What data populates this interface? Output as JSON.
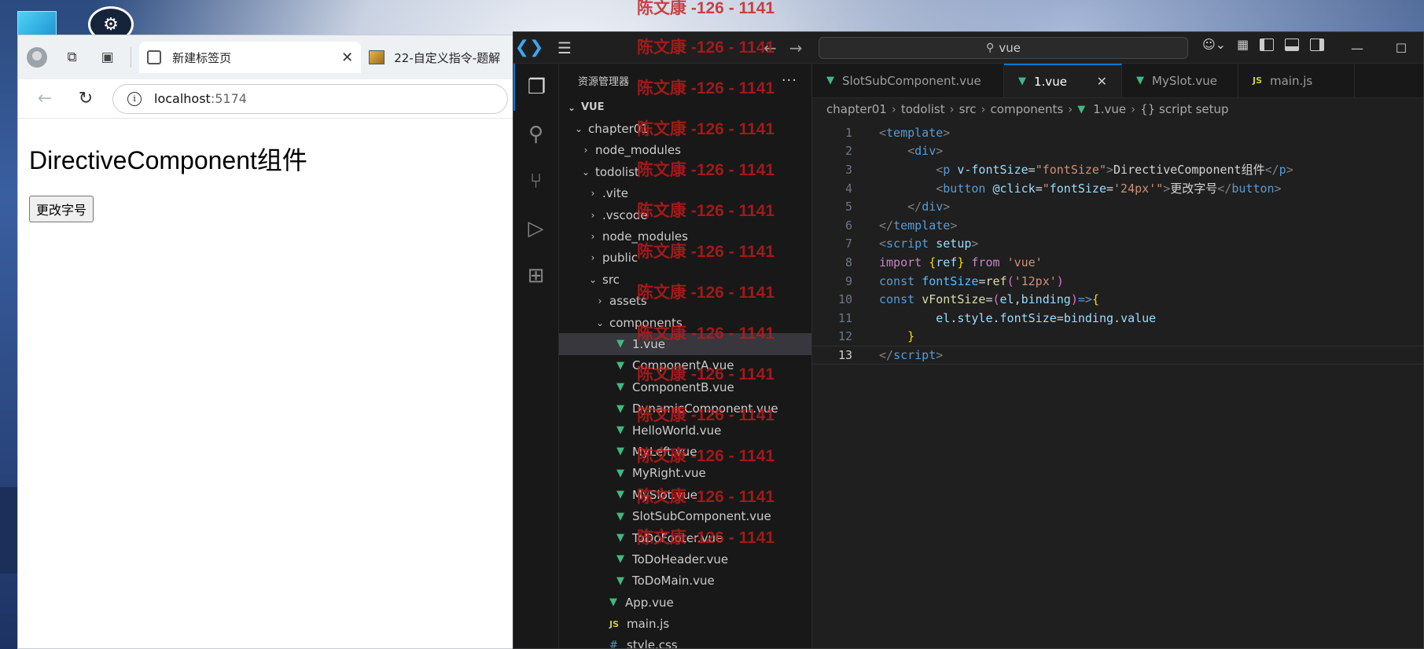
{
  "browser": {
    "tabs": [
      {
        "label": "新建标签页",
        "active": true
      },
      {
        "label": "22-自定义指令-题解",
        "active": false
      }
    ],
    "url_host": "localhost",
    "url_port": ":5174",
    "page_heading": "DirectiveComponent组件",
    "page_button": "更改字号"
  },
  "vscode": {
    "search_text": "vue",
    "explorer_title": "资源管理器",
    "tree": [
      {
        "label": "VUE",
        "depth": 0,
        "type": "root",
        "expanded": true
      },
      {
        "label": "chapter01",
        "depth": 1,
        "type": "folder",
        "expanded": true
      },
      {
        "label": "node_modules",
        "depth": 2,
        "type": "folder",
        "expanded": false
      },
      {
        "label": "todolist",
        "depth": 2,
        "type": "folder",
        "expanded": true
      },
      {
        "label": ".vite",
        "depth": 3,
        "type": "folder",
        "expanded": false
      },
      {
        "label": ".vscode",
        "depth": 3,
        "type": "folder",
        "expanded": false
      },
      {
        "label": "node_modules",
        "depth": 3,
        "type": "folder",
        "expanded": false
      },
      {
        "label": "public",
        "depth": 3,
        "type": "folder",
        "expanded": false
      },
      {
        "label": "src",
        "depth": 3,
        "type": "folder",
        "expanded": true
      },
      {
        "label": "assets",
        "depth": 4,
        "type": "folder",
        "expanded": false
      },
      {
        "label": "components",
        "depth": 4,
        "type": "folder",
        "expanded": true
      },
      {
        "label": "1.vue",
        "depth": 5,
        "type": "vue",
        "selected": true
      },
      {
        "label": "ComponentA.vue",
        "depth": 5,
        "type": "vue"
      },
      {
        "label": "ComponentB.vue",
        "depth": 5,
        "type": "vue"
      },
      {
        "label": "DynamicComponent.vue",
        "depth": 5,
        "type": "vue"
      },
      {
        "label": "HelloWorld.vue",
        "depth": 5,
        "type": "vue"
      },
      {
        "label": "MyLeft.vue",
        "depth": 5,
        "type": "vue"
      },
      {
        "label": "MyRight.vue",
        "depth": 5,
        "type": "vue"
      },
      {
        "label": "MySlot.vue",
        "depth": 5,
        "type": "vue"
      },
      {
        "label": "SlotSubComponent.vue",
        "depth": 5,
        "type": "vue"
      },
      {
        "label": "ToDoFooter.vue",
        "depth": 5,
        "type": "vue"
      },
      {
        "label": "ToDoHeader.vue",
        "depth": 5,
        "type": "vue"
      },
      {
        "label": "ToDoMain.vue",
        "depth": 5,
        "type": "vue"
      },
      {
        "label": "App.vue",
        "depth": 4,
        "type": "vue"
      },
      {
        "label": "main.js",
        "depth": 4,
        "type": "js"
      },
      {
        "label": "style.css",
        "depth": 4,
        "type": "css"
      }
    ],
    "editor_tabs": [
      {
        "label": "SlotSubComponent.vue",
        "type": "vue",
        "active": false
      },
      {
        "label": "1.vue",
        "type": "vue",
        "active": true
      },
      {
        "label": "MySlot.vue",
        "type": "vue",
        "active": false
      },
      {
        "label": "main.js",
        "type": "js",
        "active": false
      }
    ],
    "breadcrumb": [
      "chapter01",
      "todolist",
      "src",
      "components",
      "1.vue",
      "{} script setup"
    ],
    "current_line": 13,
    "code_lines": [
      [
        [
          "t-bracket",
          "<"
        ],
        [
          "t-tag",
          "template"
        ],
        [
          "t-bracket",
          ">"
        ]
      ],
      [
        [
          "",
          "    "
        ],
        [
          "t-bracket",
          "<"
        ],
        [
          "t-tag",
          "div"
        ],
        [
          "t-bracket",
          ">"
        ]
      ],
      [
        [
          "",
          "        "
        ],
        [
          "t-bracket",
          "<"
        ],
        [
          "t-tag",
          "p"
        ],
        [
          "",
          " "
        ],
        [
          "t-attr",
          "v-fontSize"
        ],
        [
          "t-text",
          "="
        ],
        [
          "t-str",
          "\"fontSize\""
        ],
        [
          "t-bracket",
          ">"
        ],
        [
          "t-text",
          "DirectiveComponent组件"
        ],
        [
          "t-bracket",
          "</"
        ],
        [
          "t-tag",
          "p"
        ],
        [
          "t-bracket",
          ">"
        ]
      ],
      [
        [
          "",
          "        "
        ],
        [
          "t-bracket",
          "<"
        ],
        [
          "t-tag",
          "button"
        ],
        [
          "",
          " "
        ],
        [
          "t-attr",
          "@click"
        ],
        [
          "t-text",
          "="
        ],
        [
          "t-str",
          "\""
        ],
        [
          "t-var",
          "fontSize"
        ],
        [
          "t-text",
          "="
        ],
        [
          "t-str",
          "'24px'"
        ],
        [
          "t-str",
          "\""
        ],
        [
          "t-bracket",
          ">"
        ],
        [
          "t-text",
          "更改字号"
        ],
        [
          "t-bracket",
          "</"
        ],
        [
          "t-tag",
          "button"
        ],
        [
          "t-bracket",
          ">"
        ]
      ],
      [
        [
          "",
          "    "
        ],
        [
          "t-bracket",
          "</"
        ],
        [
          "t-tag",
          "div"
        ],
        [
          "t-bracket",
          ">"
        ]
      ],
      [
        [
          "t-bracket",
          "</"
        ],
        [
          "t-tag",
          "template"
        ],
        [
          "t-bracket",
          ">"
        ]
      ],
      [
        [
          "t-bracket",
          "<"
        ],
        [
          "t-tag",
          "script"
        ],
        [
          "",
          " "
        ],
        [
          "t-attr",
          "setup"
        ],
        [
          "t-bracket",
          ">"
        ]
      ],
      [
        [
          "t-kw2",
          "import"
        ],
        [
          "",
          " "
        ],
        [
          "t-brace",
          "{"
        ],
        [
          "t-var",
          "ref"
        ],
        [
          "t-brace",
          "}"
        ],
        [
          "",
          " "
        ],
        [
          "t-kw2",
          "from"
        ],
        [
          "",
          " "
        ],
        [
          "t-str",
          "'vue'"
        ]
      ],
      [
        [
          "t-kw",
          "const"
        ],
        [
          "",
          " "
        ],
        [
          "t-const",
          "fontSize"
        ],
        [
          "t-text",
          "="
        ],
        [
          "t-fn",
          "ref"
        ],
        [
          "t-paren",
          "("
        ],
        [
          "t-str",
          "'12px'"
        ],
        [
          "t-paren",
          ")"
        ]
      ],
      [
        [
          "t-kw",
          "const"
        ],
        [
          "",
          " "
        ],
        [
          "t-fn",
          "vFontSize"
        ],
        [
          "t-text",
          "="
        ],
        [
          "t-paren",
          "("
        ],
        [
          "t-var",
          "el"
        ],
        [
          "t-text",
          ","
        ],
        [
          "t-var",
          "binding"
        ],
        [
          "t-paren",
          ")"
        ],
        [
          "t-kw",
          "=>"
        ],
        [
          "t-brace",
          "{"
        ]
      ],
      [
        [
          "",
          "        "
        ],
        [
          "t-var",
          "el"
        ],
        [
          "t-text",
          "."
        ],
        [
          "t-var",
          "style"
        ],
        [
          "t-text",
          "."
        ],
        [
          "t-var",
          "fontSize"
        ],
        [
          "t-text",
          "="
        ],
        [
          "t-var",
          "binding"
        ],
        [
          "t-text",
          "."
        ],
        [
          "t-var",
          "value"
        ]
      ],
      [
        [
          "",
          "    "
        ],
        [
          "t-brace",
          "}"
        ]
      ],
      [
        [
          "t-bracket",
          "</"
        ],
        [
          "t-tag",
          "script"
        ],
        [
          "t-bracket",
          ">"
        ]
      ]
    ]
  },
  "watermark": "陈文康 -126 - 1141"
}
